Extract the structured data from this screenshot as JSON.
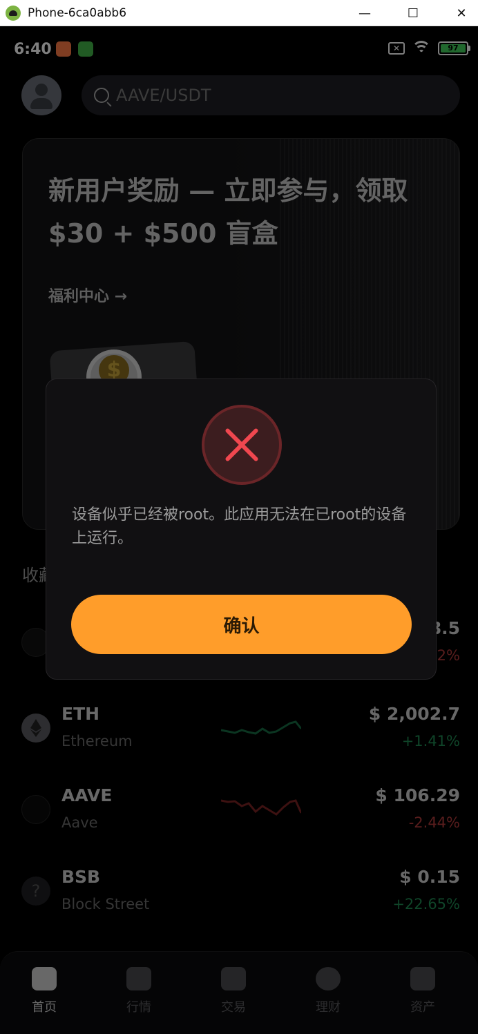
{
  "window": {
    "title": "Phone-6ca0abb6",
    "minimize": "—",
    "maximize": "☐",
    "close": "✕"
  },
  "status_bar": {
    "time": "6:40",
    "battery": "97"
  },
  "search": {
    "placeholder": "AAVE/USDT"
  },
  "banner": {
    "title": "新用户奖励 — 立即参与，领取 $30 + $500 盲盒",
    "link": "福利中心 →"
  },
  "favorites": {
    "title": "收藏"
  },
  "coins": [
    {
      "symbol": "",
      "name": "",
      "price": "8.5",
      "change": "2%",
      "trend": "neg"
    },
    {
      "symbol": "ETH",
      "name": "Ethereum",
      "price": "$ 2,002.7",
      "change": "+1.41%",
      "trend": "pos"
    },
    {
      "symbol": "AAVE",
      "name": "Aave",
      "price": "$ 106.29",
      "change": "-2.44%",
      "trend": "neg"
    },
    {
      "symbol": "BSB",
      "name": "Block Street",
      "price": "$ 0.15",
      "change": "+22.65%",
      "trend": "pos"
    }
  ],
  "tabs": [
    {
      "label": "首页",
      "icon": "home-icon",
      "active": true
    },
    {
      "label": "行情",
      "icon": "chart-icon",
      "active": false
    },
    {
      "label": "交易",
      "icon": "trade-icon",
      "active": false
    },
    {
      "label": "理财",
      "icon": "percent-icon",
      "active": false
    },
    {
      "label": "资产",
      "icon": "wallet-icon",
      "active": false
    }
  ],
  "dialog": {
    "message": "设备似乎已经被root。此应用无法在已root的设备上运行。",
    "confirm_label": "确认",
    "icon": "error-icon"
  },
  "colors": {
    "accent": "#ff9d2a",
    "error": "#f0474f",
    "positive": "#1f8a52",
    "negative": "#b23a3a"
  }
}
